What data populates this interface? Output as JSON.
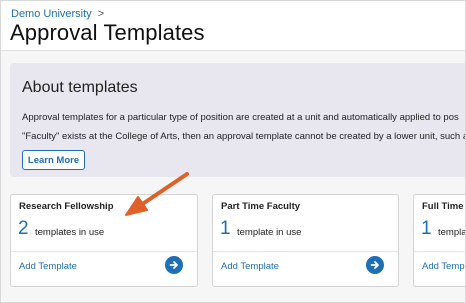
{
  "breadcrumb": {
    "link": "Demo University",
    "separator": ">"
  },
  "page_title": "Approval Templates",
  "about": {
    "heading": "About templates",
    "line1": "Approval templates for a particular type of position are created at a unit and automatically applied to pos",
    "line2": "\"Faculty\" exists at the College of Arts, then an approval template cannot be created by a lower unit, such a",
    "learn_more": "Learn More"
  },
  "cards": [
    {
      "title": "Research Fellowship",
      "count": "2",
      "count_label": "templates in use",
      "link": "Add Template"
    },
    {
      "title": "Part Time Faculty",
      "count": "1",
      "count_label": "template in use",
      "link": "Add Template"
    },
    {
      "title": "Full Time",
      "count": "1",
      "count_label": "template",
      "link": "Add Temp"
    }
  ],
  "colors": {
    "accent": "#1f6fb5",
    "annotation_arrow": "#e0602a",
    "about_bg": "#e8e6ef"
  },
  "icons": {
    "card_action": "arrow-right-circle-icon"
  }
}
